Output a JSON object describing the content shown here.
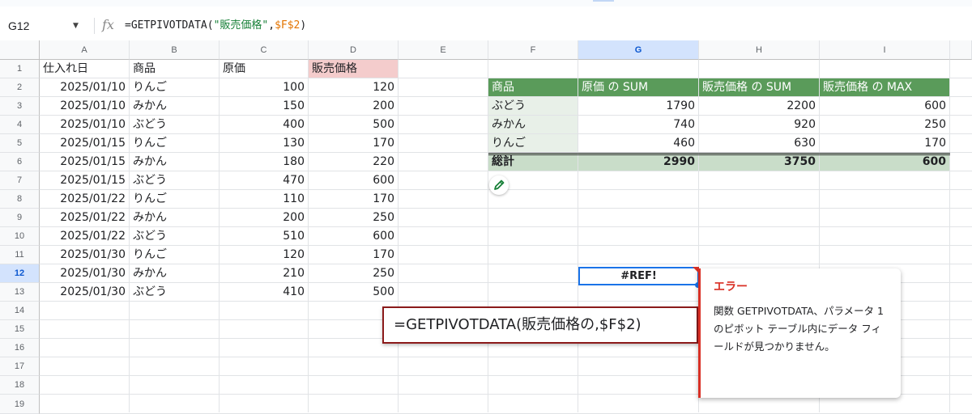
{
  "formula_bar": {
    "name_box": "G12",
    "fx": "fx",
    "formula_prefix": "=GETPIVOTDATA(",
    "formula_string": "\"販売価格\"",
    "formula_comma": ",",
    "formula_ref": "$F$2",
    "formula_suffix": ")"
  },
  "columns": [
    "A",
    "B",
    "C",
    "D",
    "E",
    "F",
    "G",
    "H",
    "I"
  ],
  "rows": [
    "1",
    "2",
    "3",
    "4",
    "5",
    "6",
    "7",
    "8",
    "9",
    "10",
    "11",
    "12",
    "13",
    "14",
    "15",
    "16",
    "17",
    "18",
    "19"
  ],
  "table": {
    "headers": [
      "仕入れ日",
      "商品",
      "原価",
      "販売価格"
    ],
    "rows": [
      [
        "2025/01/10",
        "りんご",
        "100",
        "120"
      ],
      [
        "2025/01/10",
        "みかん",
        "150",
        "200"
      ],
      [
        "2025/01/10",
        "ぶどう",
        "400",
        "500"
      ],
      [
        "2025/01/15",
        "りんご",
        "130",
        "170"
      ],
      [
        "2025/01/15",
        "みかん",
        "180",
        "220"
      ],
      [
        "2025/01/15",
        "ぶどう",
        "470",
        "600"
      ],
      [
        "2025/01/22",
        "りんご",
        "110",
        "170"
      ],
      [
        "2025/01/22",
        "みかん",
        "200",
        "250"
      ],
      [
        "2025/01/22",
        "ぶどう",
        "510",
        "600"
      ],
      [
        "2025/01/30",
        "りんご",
        "120",
        "170"
      ],
      [
        "2025/01/30",
        "みかん",
        "210",
        "250"
      ],
      [
        "2025/01/30",
        "ぶどう",
        "410",
        "500"
      ]
    ]
  },
  "pivot": {
    "headers": [
      "商品",
      "原価 の SUM",
      "販売価格 の SUM",
      "販売価格 の MAX"
    ],
    "rows": [
      [
        "ぶどう",
        "1790",
        "2200",
        "600"
      ],
      [
        "みかん",
        "740",
        "920",
        "250"
      ],
      [
        "りんご",
        "460",
        "630",
        "170"
      ]
    ],
    "total": [
      "総計",
      "2990",
      "3750",
      "600"
    ]
  },
  "selected_cell_value": "#REF!",
  "formula_popup": "=GETPIVOTDATA(販売価格の,$F$2)",
  "error": {
    "title": "エラー",
    "message": "関数 GETPIVOTDATA、パラメータ 1 のピボット テーブル内にデータ フィールドが見つかりません。"
  },
  "colors": {
    "pivot_header": "#5a9b5a",
    "pivot_total": "#c9ddc9",
    "error_red": "#d93025",
    "selection_blue": "#1a73e8",
    "header_pink": "#f4cccc"
  },
  "icons": [
    "dropdown-caret-icon",
    "fx-icon",
    "pencil-icon"
  ]
}
